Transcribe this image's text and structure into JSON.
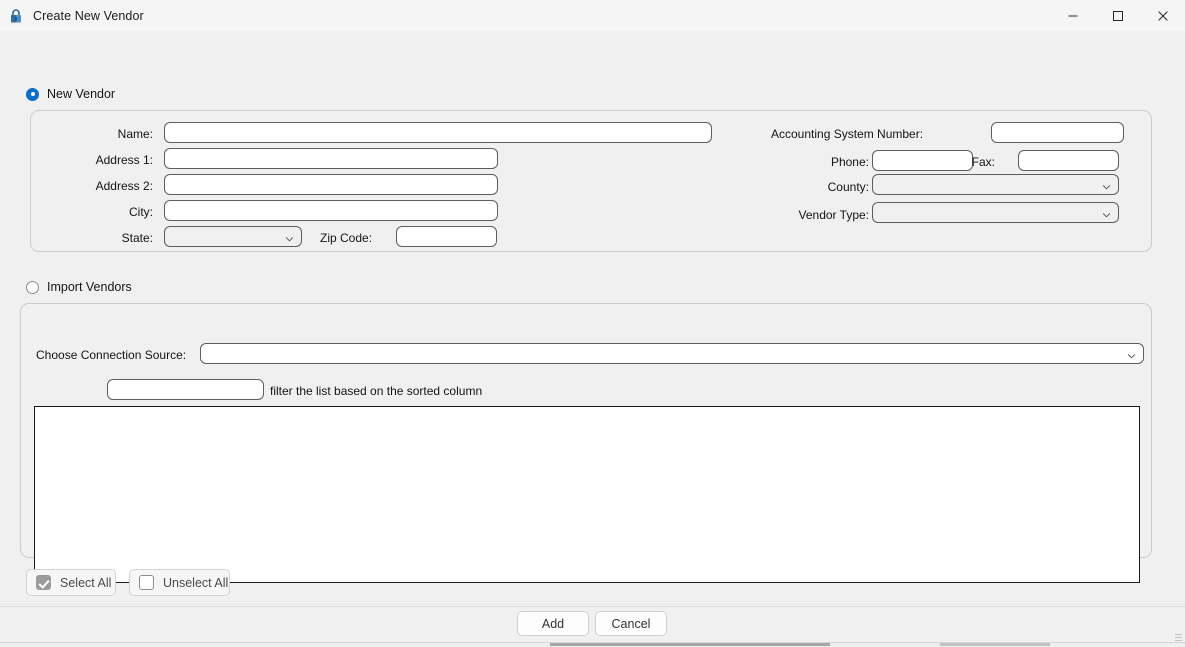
{
  "window": {
    "title": "Create New Vendor",
    "icon": "lock-icon",
    "controls": {
      "minimize": "─",
      "maximize": "☐",
      "close": "✕"
    },
    "accent": "#0b6fc9"
  },
  "new_vendor": {
    "radio_label": "New Vendor",
    "selected": true,
    "fields": {
      "name": {
        "label": "Name:",
        "value": "",
        "placeholder": ""
      },
      "address1": {
        "label": "Address 1:",
        "value": "",
        "placeholder": ""
      },
      "address2": {
        "label": "Address 2:",
        "value": "",
        "placeholder": ""
      },
      "city": {
        "label": "City:",
        "value": "",
        "placeholder": ""
      },
      "state": {
        "label": "State:",
        "value": "",
        "options": []
      },
      "zip": {
        "label": "Zip Code:",
        "value": "",
        "placeholder": ""
      },
      "accounting_system_number": {
        "label": "Accounting System Number:",
        "value": "",
        "placeholder": ""
      },
      "phone": {
        "label": "Phone:",
        "value": "",
        "placeholder": ""
      },
      "fax": {
        "label": "Fax:",
        "value": "",
        "placeholder": ""
      },
      "county": {
        "label": "County:",
        "value": "",
        "options": []
      },
      "vendor_type": {
        "label": "Vendor Type:",
        "value": "",
        "options": []
      }
    }
  },
  "import_vendors": {
    "radio_label": "Import Vendors",
    "selected": false,
    "connection_source": {
      "label": "Choose Connection Source:",
      "value": "",
      "options": []
    },
    "filter": {
      "value": "",
      "placeholder": "",
      "hint": "filter the list based on the sorted column"
    },
    "list": {
      "items": []
    },
    "select_all": {
      "label": "Select All",
      "checked": true
    },
    "unselect_all": {
      "label": "Unselect All",
      "checked": false
    }
  },
  "footer": {
    "add_label": "Add",
    "cancel_label": "Cancel"
  }
}
